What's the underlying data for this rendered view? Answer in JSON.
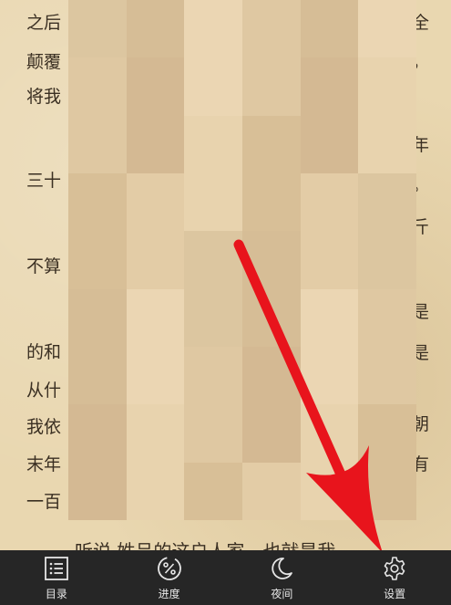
{
  "reader": {
    "left_fragments": [
      "之后",
      "颠覆",
      "将我",
      "三十",
      "不算",
      "的和",
      "从什",
      "我依",
      "末年",
      "一百"
    ],
    "right_fragments": [
      "全",
      "，",
      "年",
      "。",
      "斤",
      "是",
      "是",
      "朝",
      "有"
    ],
    "bottom_partial": "听说   姓吕的这户人家，也就是我"
  },
  "toolbar": {
    "catalog_label": "目录",
    "progress_label": "进度",
    "night_label": "夜间",
    "settings_label": "设置"
  },
  "colors": {
    "page_bg": "#e9d7b0",
    "text": "#3a2f22",
    "toolbar_bg": "#262626",
    "toolbar_text": "#e6e6e6",
    "arrow": "#e8141c"
  },
  "icons": [
    "list-icon",
    "percent-icon",
    "moon-icon",
    "gear-icon"
  ]
}
